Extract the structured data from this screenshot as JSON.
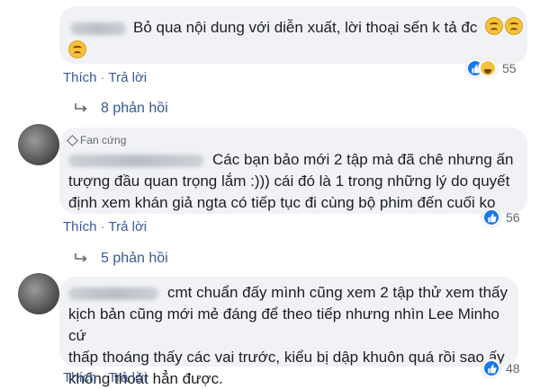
{
  "comments": [
    {
      "text_line1": "Bỏ qua nội dung với diễn xuất, lời thoại sến k tả đc",
      "actions": {
        "like": "Thích",
        "reply": "Trả lời"
      },
      "reaction_count": "55",
      "replies_label": "8 phản hồi"
    },
    {
      "badge": "Fan cứng",
      "text_line1": "Các bạn bảo mới 2 tập mà đã chê nhưng ấn",
      "text_line2": "tượng đầu quan trọng lắm :))) cái đó là 1 trong những lý do quyết",
      "text_line3": "định xem khán giả ngta có tiếp tục đi cùng bộ phim đến cuối ko",
      "actions": {
        "like": "Thích",
        "reply": "Trả lời"
      },
      "reaction_count": "56",
      "replies_label": "5 phản hồi"
    },
    {
      "text_line1": "cmt chuẩn đấy mình cũng xem 2 tập thử xem thấy",
      "text_line2": "kịch bản cũng mới mẻ đáng để theo tiếp nhưng nhìn Lee Minho cứ",
      "text_line3": "thấp thoáng thấy các vai trước, kiểu bị dập khuôn quá rồi sao ấy",
      "text_line4": "không thoát hẳn được.",
      "actions": {
        "like": "Thích",
        "reply": "Trả lời"
      },
      "reaction_count": "48"
    }
  ],
  "icons": {
    "like": "like-reaction-icon",
    "haha": "haha-reaction-icon",
    "reply_arrow": "reply-arrow-icon",
    "emoji": "upside-down-face-emoji",
    "badge": "diamond-icon"
  },
  "colors": {
    "link": "#385898",
    "bubble": "#f0f2f5",
    "like_blue": "#1877f2",
    "meta_text": "#65676b"
  }
}
